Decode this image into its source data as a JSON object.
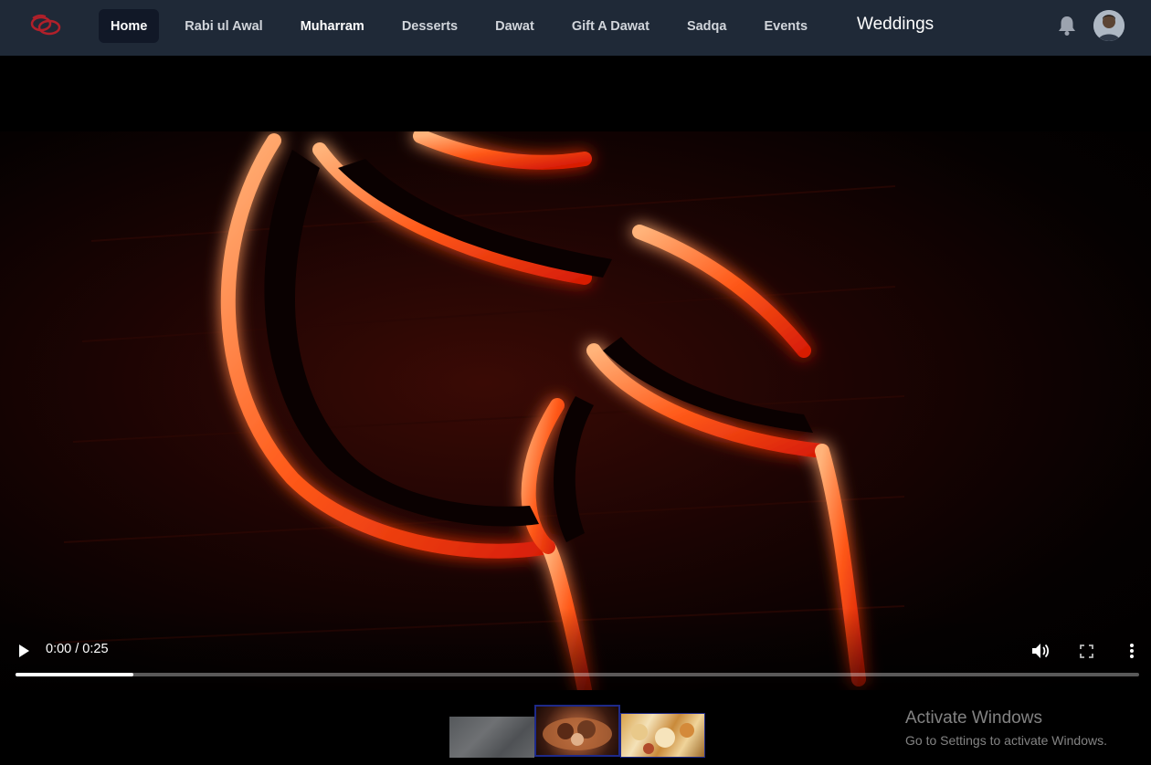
{
  "navbar": {
    "logo_icon": "brand-logo-icon",
    "items": [
      {
        "label": "Home",
        "active": true
      },
      {
        "label": "Rabi ul Awal"
      },
      {
        "label": "Muharram"
      },
      {
        "label": "Desserts"
      },
      {
        "label": "Dawat"
      },
      {
        "label": "Gift A Dawat"
      },
      {
        "label": "Sadqa"
      },
      {
        "label": "Events"
      }
    ],
    "weddings_label": "Weddings",
    "bell_icon": "bell-icon",
    "avatar_icon": "user-avatar"
  },
  "video": {
    "time": "0:00 / 0:25",
    "progress": 0.105,
    "play_icon": "play-icon",
    "volume_icon": "volume-icon",
    "fullscreen_icon": "fullscreen-icon",
    "more_icon": "more-options-icon"
  },
  "thumbnails": [
    {
      "icon": "thumbnail-image",
      "selected": false
    },
    {
      "icon": "thumbnail-image",
      "selected": true
    },
    {
      "icon": "thumbnail-image",
      "selected": false
    }
  ],
  "watermark": {
    "title": "Activate Windows",
    "subtitle": "Go to Settings to activate Windows."
  },
  "colors": {
    "navbar_bg": "#1f2937",
    "nav_active_bg": "#111827",
    "thumb_border": "#1e2a8a"
  }
}
